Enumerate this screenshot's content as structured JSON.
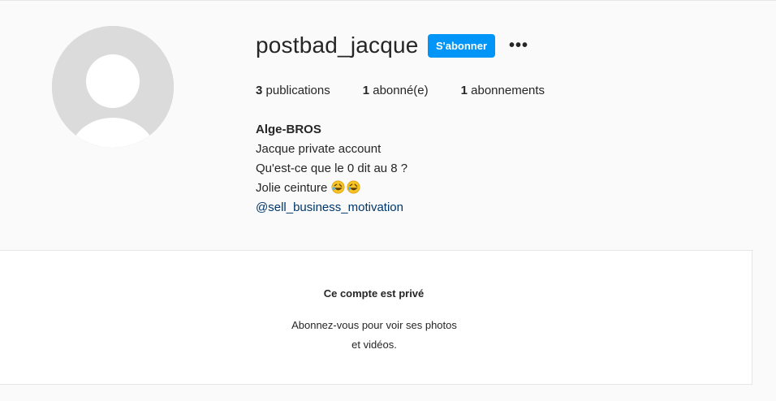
{
  "profile": {
    "username": "postbad_jacque",
    "follow_button": "S'abonner",
    "more_options": "•••",
    "stats": {
      "posts_count": "3",
      "posts_label": "publications",
      "followers_count": "1",
      "followers_label": "abonné(e)",
      "following_count": "1",
      "following_label": "abonnements"
    },
    "bio": {
      "name": "Alge-BROS",
      "line1": "Jacque private account",
      "line2": "Qu'est-ce que le 0 dit au 8 ?",
      "line3": "Jolie ceinture",
      "line3_emojis": [
        "rolling-on-floor-laughing-emoji",
        "rolling-on-floor-laughing-emoji"
      ],
      "link": "@sell_business_motivation"
    }
  },
  "private_notice": {
    "title": "Ce compte est privé",
    "message_line1": "Abonnez-vous pour voir ses photos",
    "message_line2": "et vidéos."
  },
  "colors": {
    "accent": "#0095f6",
    "link": "#00376b",
    "background": "#fafafa"
  }
}
